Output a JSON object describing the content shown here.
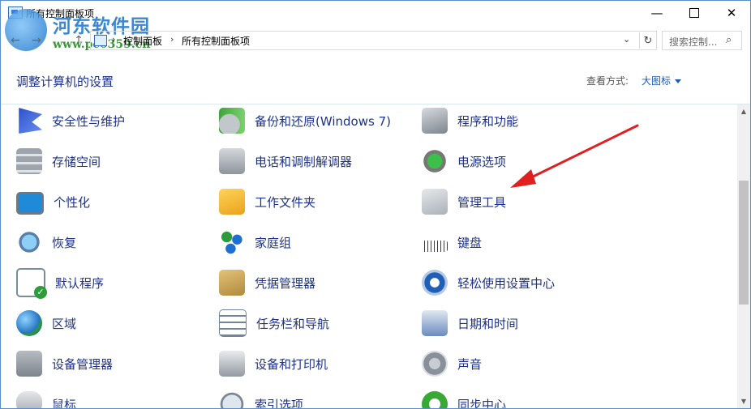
{
  "window": {
    "title": "所有控制面板项",
    "controls": {
      "minimize": "—",
      "maximize": "",
      "close": "✕"
    }
  },
  "watermark": {
    "title": "河东软件园",
    "url": "www.pc0359.cn"
  },
  "nav": {
    "back": "←",
    "forward": "→",
    "up": "↑",
    "breadcrumbs": [
      "控制面板",
      "所有控制面板项"
    ],
    "dropdown_arrow": "⌄",
    "refresh": "↻",
    "search_placeholder": "搜索控制...",
    "search_icon": "⌕"
  },
  "header": {
    "heading": "调整计算机的设置",
    "view_by_label": "查看方式:",
    "view_by_value": "大图标"
  },
  "items": [
    {
      "label": "安全性与维护",
      "icon": "flag-icon"
    },
    {
      "label": "备份和还原(Windows 7)",
      "icon": "backup-icon"
    },
    {
      "label": "程序和功能",
      "icon": "programs-icon"
    },
    {
      "label": "存储空间",
      "icon": "storage-icon"
    },
    {
      "label": "电话和调制解调器",
      "icon": "phone-icon"
    },
    {
      "label": "电源选项",
      "icon": "power-icon"
    },
    {
      "label": "个性化",
      "icon": "monitor-icon"
    },
    {
      "label": "工作文件夹",
      "icon": "folder-icon"
    },
    {
      "label": "管理工具",
      "icon": "admin-tools-icon"
    },
    {
      "label": "恢复",
      "icon": "recovery-icon"
    },
    {
      "label": "家庭组",
      "icon": "homegroup-icon"
    },
    {
      "label": "键盘",
      "icon": "keyboard-icon"
    },
    {
      "label": "默认程序",
      "icon": "default-programs-icon"
    },
    {
      "label": "凭据管理器",
      "icon": "vault-icon"
    },
    {
      "label": "轻松使用设置中心",
      "icon": "accessibility-icon"
    },
    {
      "label": "区域",
      "icon": "globe-icon"
    },
    {
      "label": "任务栏和导航",
      "icon": "taskbar-icon"
    },
    {
      "label": "日期和时间",
      "icon": "datetime-icon"
    },
    {
      "label": "设备管理器",
      "icon": "device-manager-icon"
    },
    {
      "label": "设备和打印机",
      "icon": "printer-icon"
    },
    {
      "label": "声音",
      "icon": "sound-icon"
    },
    {
      "label": "鼠标",
      "icon": "mouse-icon"
    },
    {
      "label": "索引选项",
      "icon": "index-icon"
    },
    {
      "label": "同步中心",
      "icon": "sync-icon"
    }
  ],
  "scrollbar": {
    "up": "▲",
    "down": "▼"
  },
  "colors": {
    "link": "#1e3287",
    "accent": "#1a5cb0",
    "annotation": "#e02020"
  }
}
